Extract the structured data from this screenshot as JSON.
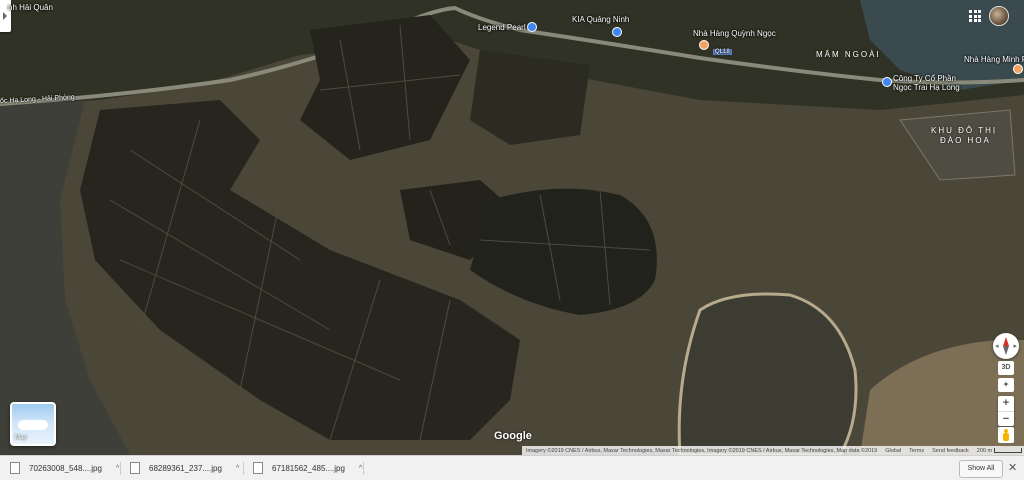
{
  "map": {
    "place_labels": {
      "hai_quan": "nh Hải Quân",
      "legend_pearl": "Legend Pearl",
      "kia": "KIA Quảng Ninh",
      "quynh_ngoc": "Nhà Hàng Quỳnh Ngọc",
      "mam_ngoai": "MÂM NGOÀI",
      "minh_ph": "Nhà Hàng Minh Ph",
      "cong_ty_1": "Công Ty Cổ Phần",
      "cong_ty_2": "Ngọc Trai Hạ Long",
      "road": "ốc Hạ Long - Hải Phòng",
      "ql18": "QL18",
      "khu_do_thi_1": "KHU ĐÔ THỊ",
      "khu_do_thi_2": "ĐÀO HOA"
    },
    "layer_toggle_label": "Map",
    "compass_left": "◂",
    "compass_right": "▸",
    "btn_3d": "3D",
    "rotate_glyph": "✦",
    "zoom_in": "+",
    "zoom_out": "−",
    "google_logo": "Google",
    "attribution": "Imagery ©2019 CNES / Airbus, Maxar Technologies, Maxar Technologies, Imagery ©2019 CNES / Airbus, Maxar Technologies, Map data ©2019",
    "footer_links": [
      "Global",
      "Terms",
      "Send feedback"
    ],
    "scale_label": "200 m",
    "colors": {
      "pin_blue": "#4285f4",
      "pin_orange": "#f4a261",
      "compass_north": "#d93025",
      "pegman": "#f4b400"
    }
  },
  "downloads": {
    "items": [
      {
        "name": "70263008_548....jpg",
        "caret": "^"
      },
      {
        "name": "68289361_237....jpg",
        "caret": "^"
      },
      {
        "name": "67181562_485....jpg",
        "caret": "^"
      }
    ],
    "show_all": "Show All",
    "close": "✕"
  }
}
